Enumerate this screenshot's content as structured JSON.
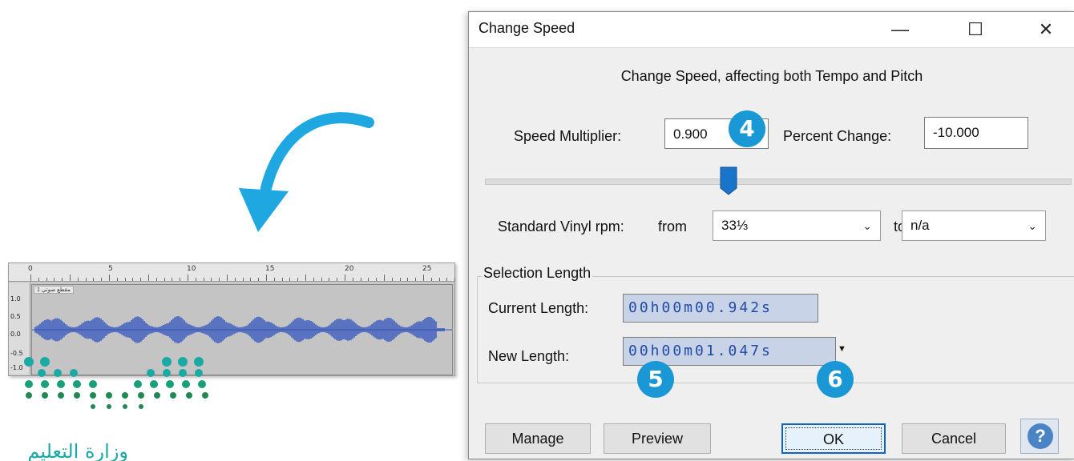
{
  "dialog": {
    "title": "Change Speed",
    "window_buttons": {
      "minimize": "—",
      "maximize": "☐",
      "close": "✕"
    },
    "subtitle": "Change Speed, affecting both Tempo and Pitch",
    "speed_multiplier_label": "Speed Multiplier:",
    "speed_multiplier_value": "0.900",
    "percent_change_label": "Percent Change:",
    "percent_change_value": "-10.000",
    "slider_level_percent": -10,
    "vinyl": {
      "label": "Standard Vinyl rpm:",
      "from_label": "from",
      "from_value": "33⅓",
      "to_label": "to",
      "to_value": "n/a"
    },
    "selection_length": {
      "caption": "Selection Length",
      "current_label": "Current Length:",
      "current_value": "00h00m00.942s",
      "new_label": "New Length:",
      "new_value": "00h00m01.047s"
    },
    "buttons": {
      "manage": "Manage",
      "preview": "Preview",
      "ok": "OK",
      "cancel": "Cancel",
      "help": "?"
    }
  },
  "badges": {
    "speed": "4",
    "preview": "5",
    "ok": "6"
  },
  "waveform": {
    "ruler_labels": [
      "0",
      "5",
      "10",
      "15",
      "20",
      "25"
    ],
    "scale_labels": [
      "1.0",
      "0.5",
      "0.0",
      "-0.5",
      "-1.0"
    ],
    "track_name": "مقطع صوتي 1"
  },
  "logo_text": "وزارة التعليم",
  "colors": {
    "accent": "#1a98d5",
    "ok_border": "#0b64c6",
    "timecode": "#1f4aa8",
    "waveform": "#3f5fc0"
  }
}
